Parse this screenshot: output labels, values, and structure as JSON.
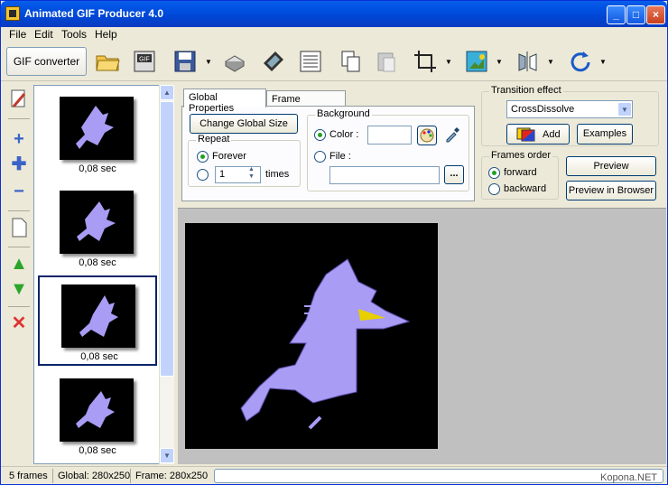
{
  "window": {
    "title": "Animated GIF Producer 4.0"
  },
  "menu": [
    "File",
    "Edit",
    "Tools",
    "Help"
  ],
  "toolbar": {
    "gif_converter": "GIF converter"
  },
  "frames": [
    {
      "duration": "0,08 sec"
    },
    {
      "duration": "0,08 sec"
    },
    {
      "duration": "0,08 sec"
    },
    {
      "duration": "0,08 sec"
    }
  ],
  "tabs": {
    "global": "Global Properties",
    "frame": "Frame Properties"
  },
  "global_props": {
    "change_size": "Change Global Size",
    "repeat_label": "Repeat",
    "forever": "Forever",
    "times_value": "1",
    "times": "times",
    "background_label": "Background",
    "color": "Color :",
    "file": "File :",
    "browse": "..."
  },
  "transition": {
    "label": "Transition effect",
    "selected": "CrossDissolve",
    "add": "Add",
    "examples": "Examples"
  },
  "frames_order": {
    "label": "Frames order",
    "forward": "forward",
    "backward": "backward"
  },
  "preview": {
    "preview": "Preview",
    "preview_browser": "Preview in Browser"
  },
  "status": {
    "frames": "5 frames",
    "global": "Global: 280x250",
    "frame": "Frame: 280x250",
    "watermark": "Kopona.NET"
  },
  "colors": {
    "accent": "#0055e5",
    "cat": "#a99cf5",
    "selection": "#0a246a"
  }
}
